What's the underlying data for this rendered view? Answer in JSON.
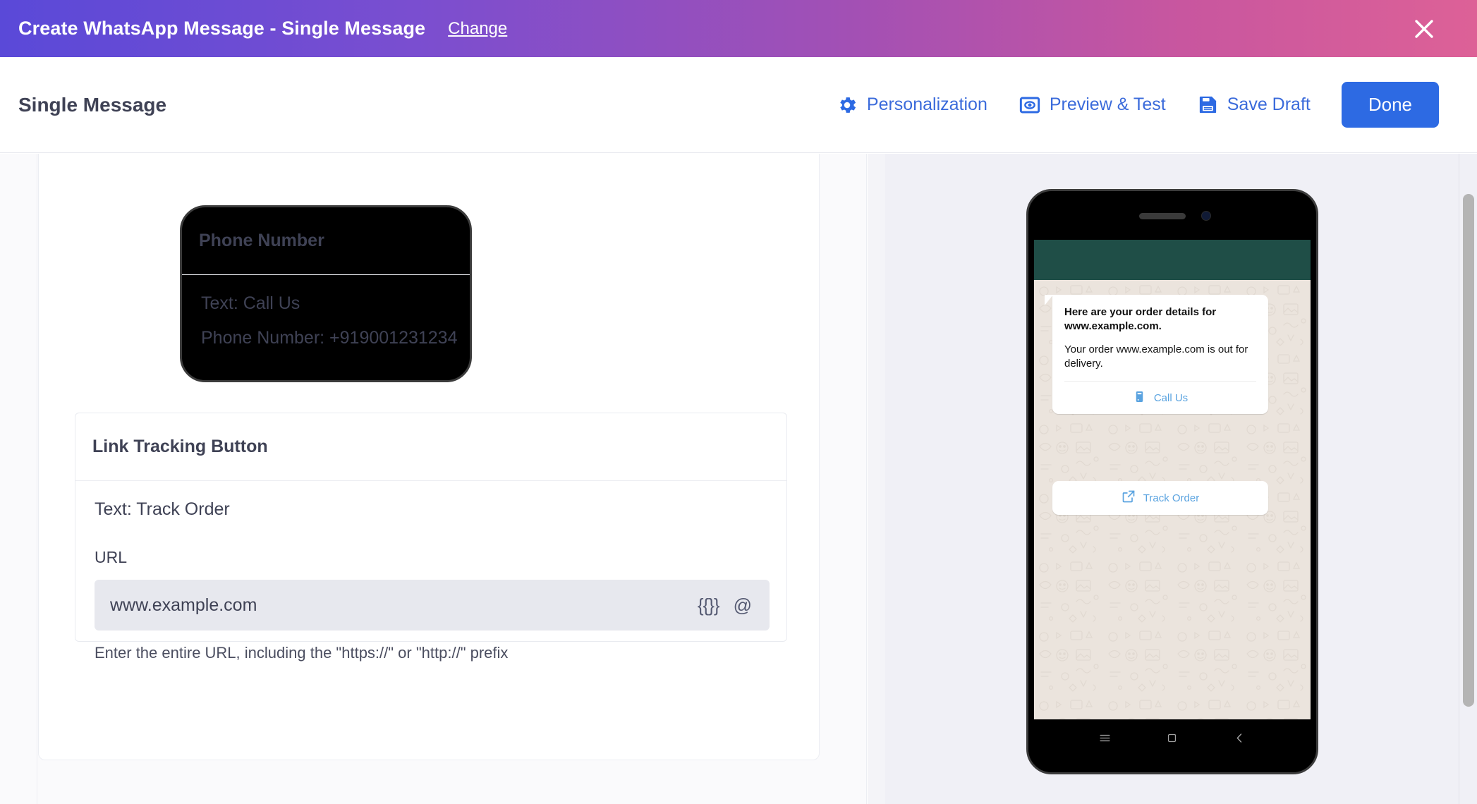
{
  "modal": {
    "title": "Create WhatsApp Message - Single Message",
    "change_link": "Change",
    "close_icon": "close-icon",
    "gradient_start": "#5a49d8",
    "gradient_end": "#dd6197"
  },
  "subheader": {
    "title": "Single Message",
    "actions": [
      {
        "label": "Personalization",
        "icon": "gear-icon"
      },
      {
        "label": "Preview & Test",
        "icon": "eye-preview-icon"
      },
      {
        "label": "Save Draft",
        "icon": "floppy-disk-icon"
      }
    ],
    "done_label": "Done",
    "accent_color": "#2d6ae3",
    "link_color": "#3b6bdb"
  },
  "form": {
    "phone_card": {
      "title": "Phone Number",
      "text_line": "Text: Call Us",
      "phone_line": "Phone Number: +919001231234",
      "text_key": "Text:",
      "text_value": "Call Us",
      "phone_key": "Phone Number:",
      "phone_value": "+919001231234"
    },
    "link_card": {
      "title": "Link Tracking Button",
      "text_line": "Text: Track Order",
      "text_key": "Text:",
      "text_value": "Track Order",
      "url_label": "URL",
      "url_value": "www.example.com",
      "url_placeholder": "www.example.com",
      "url_hint": "Enter the entire URL, including the \"https://\" or \"http://\" prefix",
      "merge_icon_label": "{{}}",
      "at_icon_label": "@"
    }
  },
  "preview": {
    "bubble": {
      "headline": "Here are your order details for www.example.com.",
      "body": "Your order www.example.com is out for delivery.",
      "call_button": {
        "label": "Call Us",
        "icon": "phone-call-icon"
      },
      "track_button": {
        "label": "Track Order",
        "icon": "external-link-icon"
      }
    },
    "whatsapp_header_color": "#1f4e47",
    "chat_background_color": "#ebe4dd",
    "link_color": "#5aa3e0",
    "nav_icons": [
      "menu-icon",
      "home-square-icon",
      "back-chevron-icon"
    ]
  }
}
